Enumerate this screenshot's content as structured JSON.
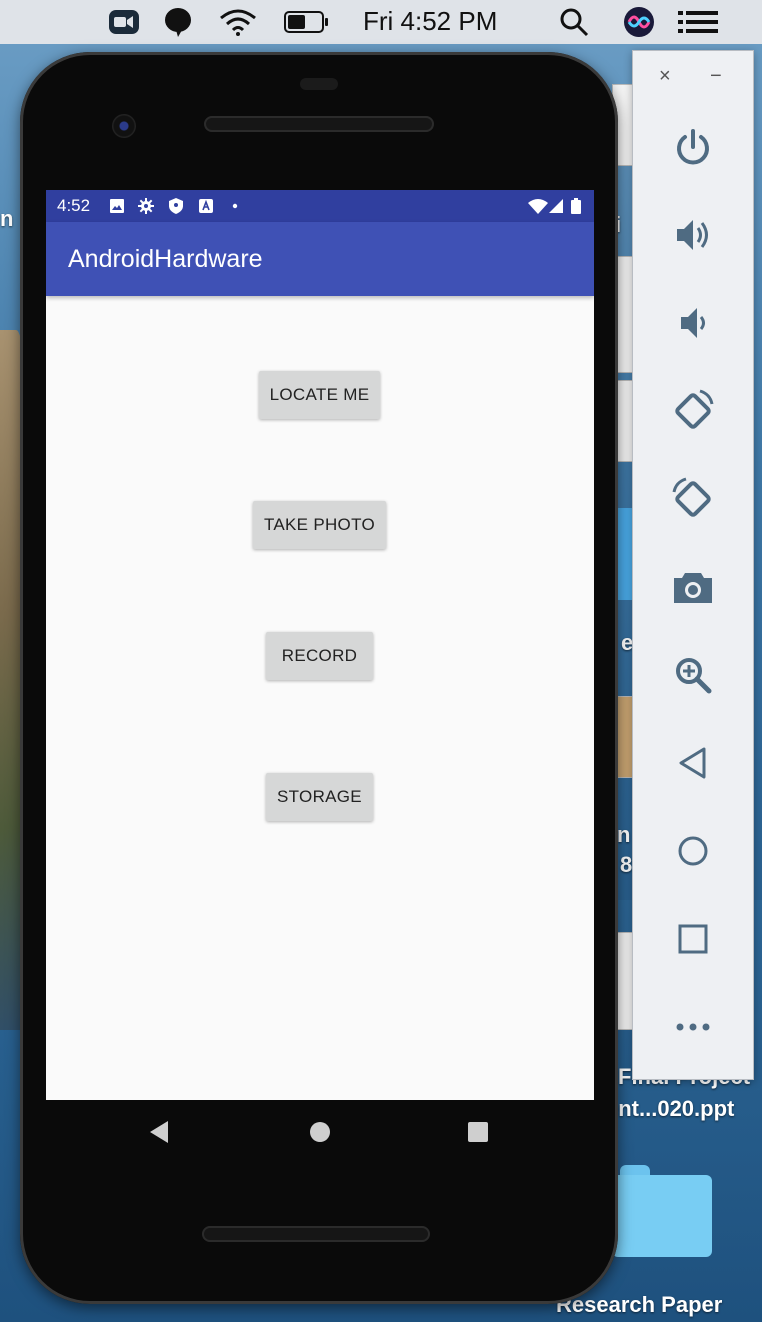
{
  "menubar": {
    "clock": "Fri 4:52 PM",
    "icons": [
      "zoom-icon",
      "speech-bubble-icon",
      "wifi-icon",
      "battery-icon",
      "search-icon",
      "siri-icon",
      "control-center-icon"
    ]
  },
  "desktop": {
    "left_fragment": "n",
    "right_fragments": [
      "i",
      "e",
      "n",
      "8"
    ],
    "file_name_line1": "Final Project",
    "file_name_line2": "ent...020.ppt",
    "folder_label": "Research Paper"
  },
  "android": {
    "status": {
      "time": "4:52",
      "icons": [
        "image-icon",
        "gear-icon",
        "shield-icon",
        "a-icon",
        "dot-icon",
        "wifi-icon",
        "signal-icon",
        "battery-icon"
      ]
    },
    "app_title": "AndroidHardware",
    "buttons": {
      "locate": "LOCATE ME",
      "photo": "TAKE PHOTO",
      "record": "RECORD",
      "storage": "STORAGE"
    },
    "nav": [
      "back-icon",
      "home-icon",
      "recents-icon"
    ]
  },
  "emulator_panel": {
    "close": "×",
    "minimize": "−",
    "controls": [
      "power-icon",
      "volume-up-icon",
      "volume-down-icon",
      "rotate-left-icon",
      "rotate-right-icon",
      "camera-icon",
      "zoom-in-icon",
      "back-icon",
      "home-icon",
      "overview-icon",
      "more-icon"
    ]
  },
  "colors": {
    "status_bar": "#303f9f",
    "app_bar": "#3f51b5",
    "button_bg": "#d6d7d7",
    "panel_icon": "#4f6b82"
  }
}
